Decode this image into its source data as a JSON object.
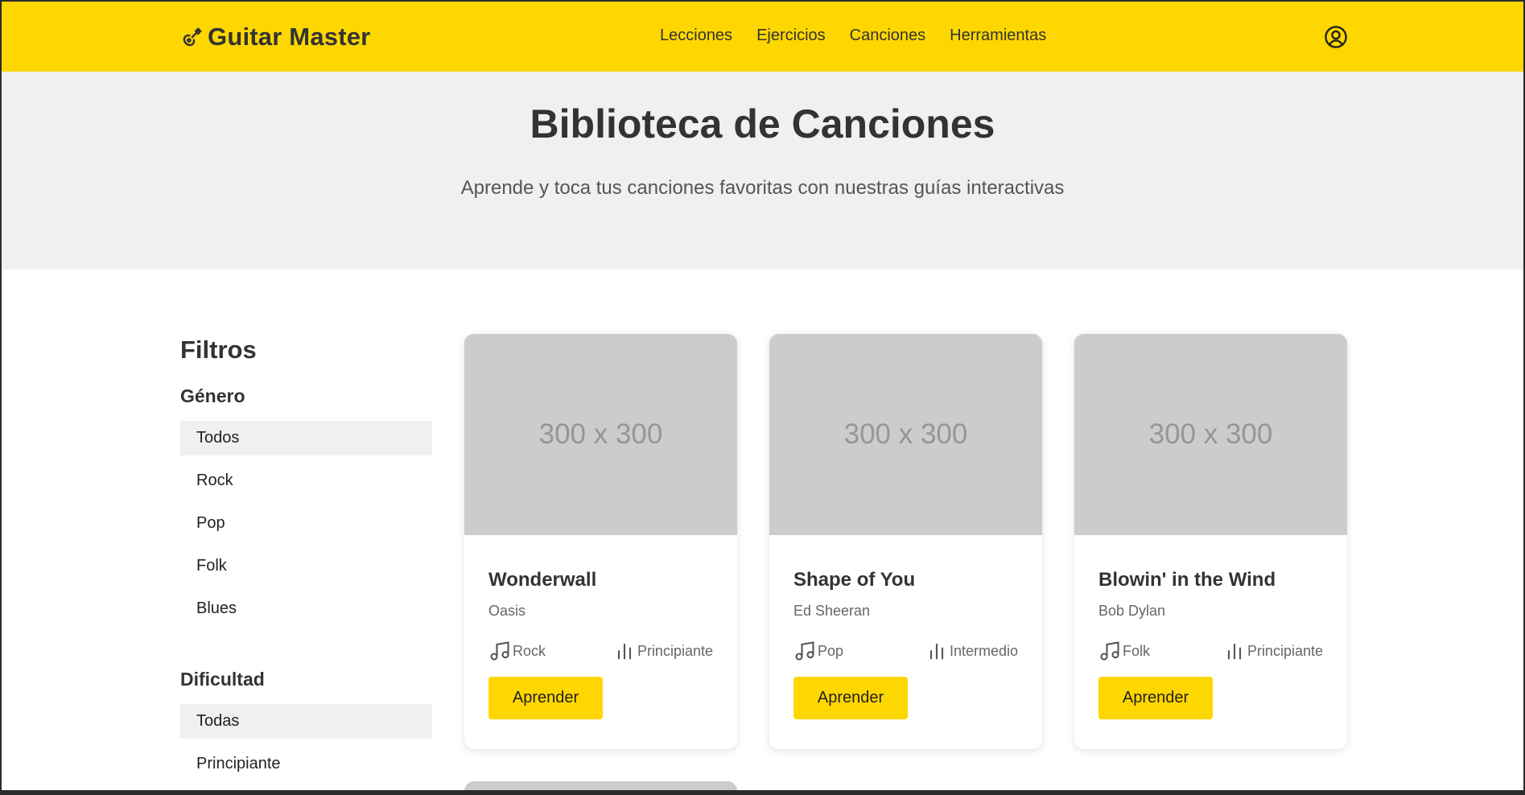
{
  "header": {
    "brand": "Guitar Master",
    "brand_icon": "guitar-icon",
    "nav": [
      {
        "label": "Lecciones"
      },
      {
        "label": "Ejercicios"
      },
      {
        "label": "Canciones"
      },
      {
        "label": "Herramientas"
      }
    ],
    "user_icon": "user-circle-icon",
    "accent_color": "#FFD700"
  },
  "hero": {
    "title": "Biblioteca de Canciones",
    "subtitle": "Aprende y toca tus canciones favoritas con nuestras guías interactivas"
  },
  "filters": {
    "title": "Filtros",
    "genre": {
      "title": "Género",
      "items": [
        {
          "label": "Todos",
          "active": true
        },
        {
          "label": "Rock"
        },
        {
          "label": "Pop"
        },
        {
          "label": "Folk"
        },
        {
          "label": "Blues"
        }
      ]
    },
    "difficulty": {
      "title": "Dificultad",
      "items": [
        {
          "label": "Todas",
          "active": true
        },
        {
          "label": "Principiante"
        }
      ]
    }
  },
  "songs": [
    {
      "image_label": "300 x 300",
      "title": "Wonderwall",
      "artist": "Oasis",
      "genre": "Rock",
      "level": "Principiante",
      "button": "Aprender"
    },
    {
      "image_label": "300 x 300",
      "title": "Shape of You",
      "artist": "Ed Sheeran",
      "genre": "Pop",
      "level": "Intermedio",
      "button": "Aprender"
    },
    {
      "image_label": "300 x 300",
      "title": "Blowin' in the Wind",
      "artist": "Bob Dylan",
      "genre": "Folk",
      "level": "Principiante",
      "button": "Aprender"
    }
  ],
  "icons": {
    "genre": "music-note-icon",
    "level": "bar-chart-icon"
  }
}
